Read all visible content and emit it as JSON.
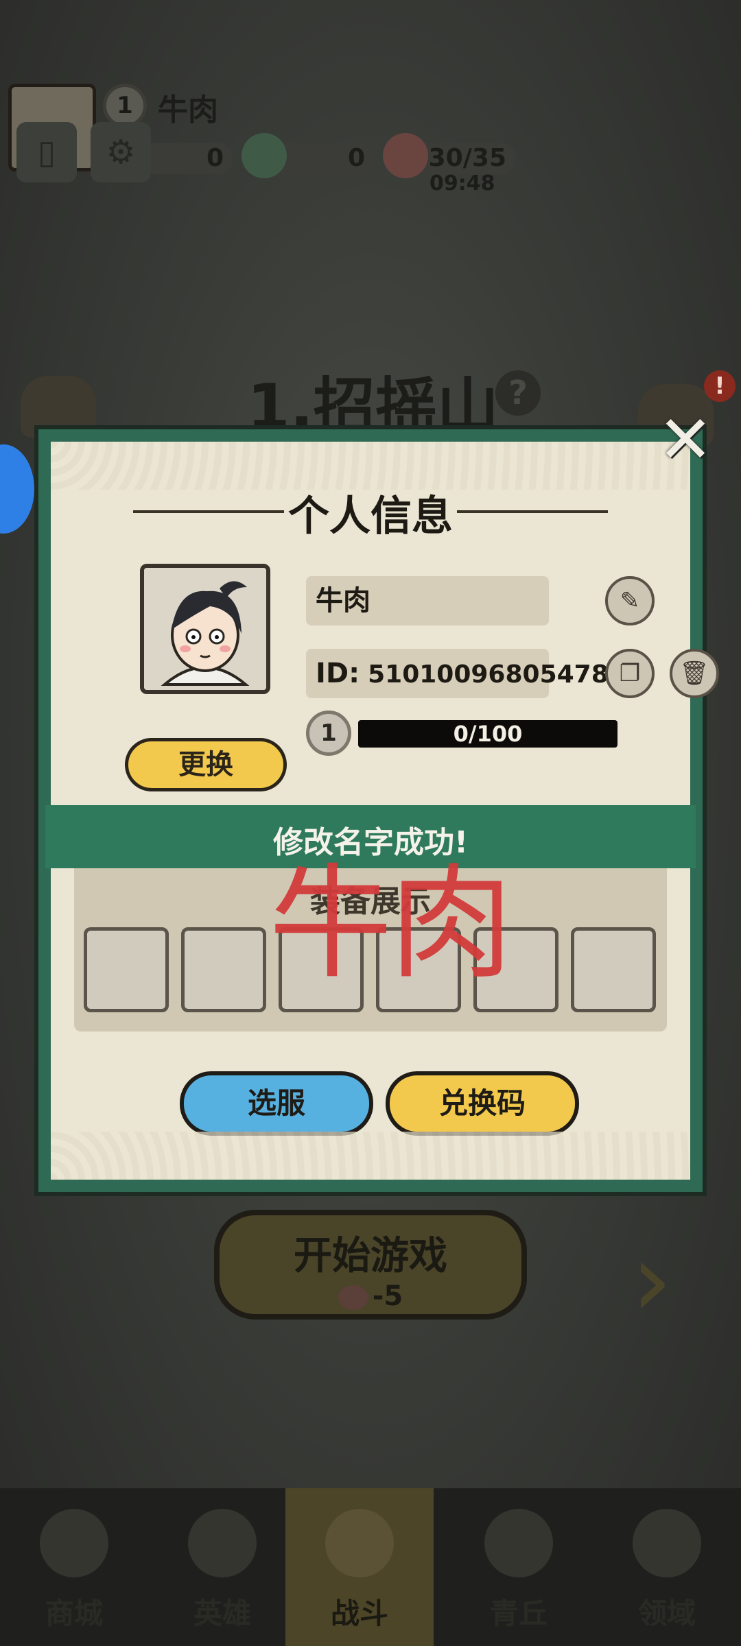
{
  "top_bar": {
    "level": "1",
    "player_name": "牛肉",
    "resources": [
      {
        "icon": "scroll-bag-icon",
        "value": "0"
      },
      {
        "icon": "jade-dragon-icon",
        "value": "0"
      },
      {
        "icon": "peach-icon",
        "value": "30/35"
      }
    ],
    "timer": "09:48",
    "buttons": [
      {
        "icon": "notebook-icon"
      },
      {
        "icon": "gear-icon"
      }
    ]
  },
  "stage": {
    "title": "1.招摇山",
    "help": "?",
    "alert": "!"
  },
  "start_button": {
    "label": "开始游戏",
    "cost": "-5"
  },
  "bottom_nav": [
    {
      "label": "商城",
      "icon": "shop-icon",
      "active": false
    },
    {
      "label": "英雄",
      "icon": "hero-helmet-icon",
      "active": false
    },
    {
      "label": "战斗",
      "icon": "crossed-swords-icon",
      "active": true
    },
    {
      "label": "青丘",
      "icon": "mountain-icon",
      "active": false
    },
    {
      "label": "领域",
      "icon": "orb-icon",
      "active": false
    }
  ],
  "modal": {
    "title": "个人信息",
    "name": "牛肉",
    "id_label": "ID:",
    "id_value": "510100968054784",
    "level": "1",
    "xp": "0/100",
    "change_label": "更换",
    "success_message": "修改名字成功!",
    "showcase_title": "装备展示",
    "stamp_text": "牛肉",
    "select_server_label": "选服",
    "redeem_label": "兑换码",
    "close": "✕"
  },
  "colors": {
    "modal_frame": "#2f6b54",
    "parchment": "#ebe5d3",
    "yellow_button": "#f2c94c",
    "blue_button": "#57b1e0",
    "stamp_red": "#d23b3b"
  }
}
